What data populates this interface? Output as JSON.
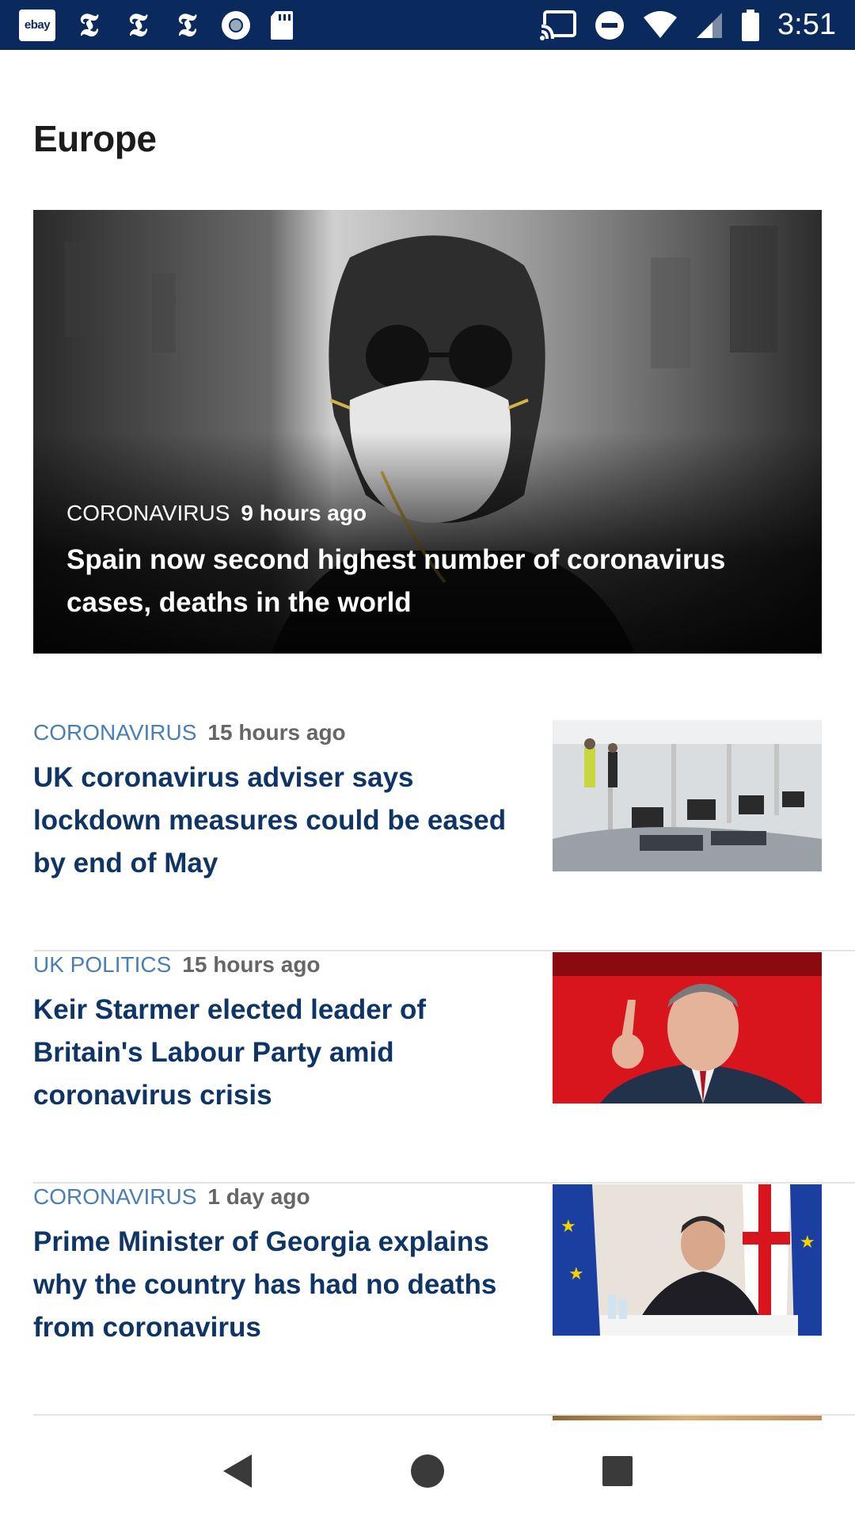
{
  "status_bar": {
    "time": "3:51",
    "left_icons": [
      "ebay-icon",
      "nyt-icon",
      "nyt-icon",
      "nyt-icon",
      "circle-dot-icon",
      "sd-card-icon"
    ],
    "ebay_label": "ebay",
    "nyt_glyph": "𝕿",
    "right_icons": [
      "cast-icon",
      "do-not-disturb-icon",
      "wifi-icon",
      "signal-icon",
      "battery-icon"
    ]
  },
  "section": {
    "title": "Europe"
  },
  "hero": {
    "category": "CORONAVIRUS",
    "time": "9 hours ago",
    "headline": "Spain now second highest number of coronavirus cases, deaths in the world"
  },
  "articles": [
    {
      "category": "CORONAVIRUS",
      "time": "15 hours ago",
      "headline": "UK coronavirus adviser says lockdown measures could be eased by end of May"
    },
    {
      "category": "UK POLITICS",
      "time": "15 hours ago",
      "headline": "Keir Starmer elected leader of Britain's Labour Party amid coronavirus crisis"
    },
    {
      "category": "CORONAVIRUS",
      "time": "1 day ago",
      "headline": "Prime Minister of Georgia explains why the country has had no deaths from coronavirus"
    }
  ],
  "colors": {
    "status_bar": "#0a2a5e",
    "headline": "#0f3567",
    "category": "#4a7fb5",
    "time": "#666666"
  },
  "nav": {
    "icons": [
      "back-icon",
      "home-icon",
      "recents-icon"
    ]
  }
}
